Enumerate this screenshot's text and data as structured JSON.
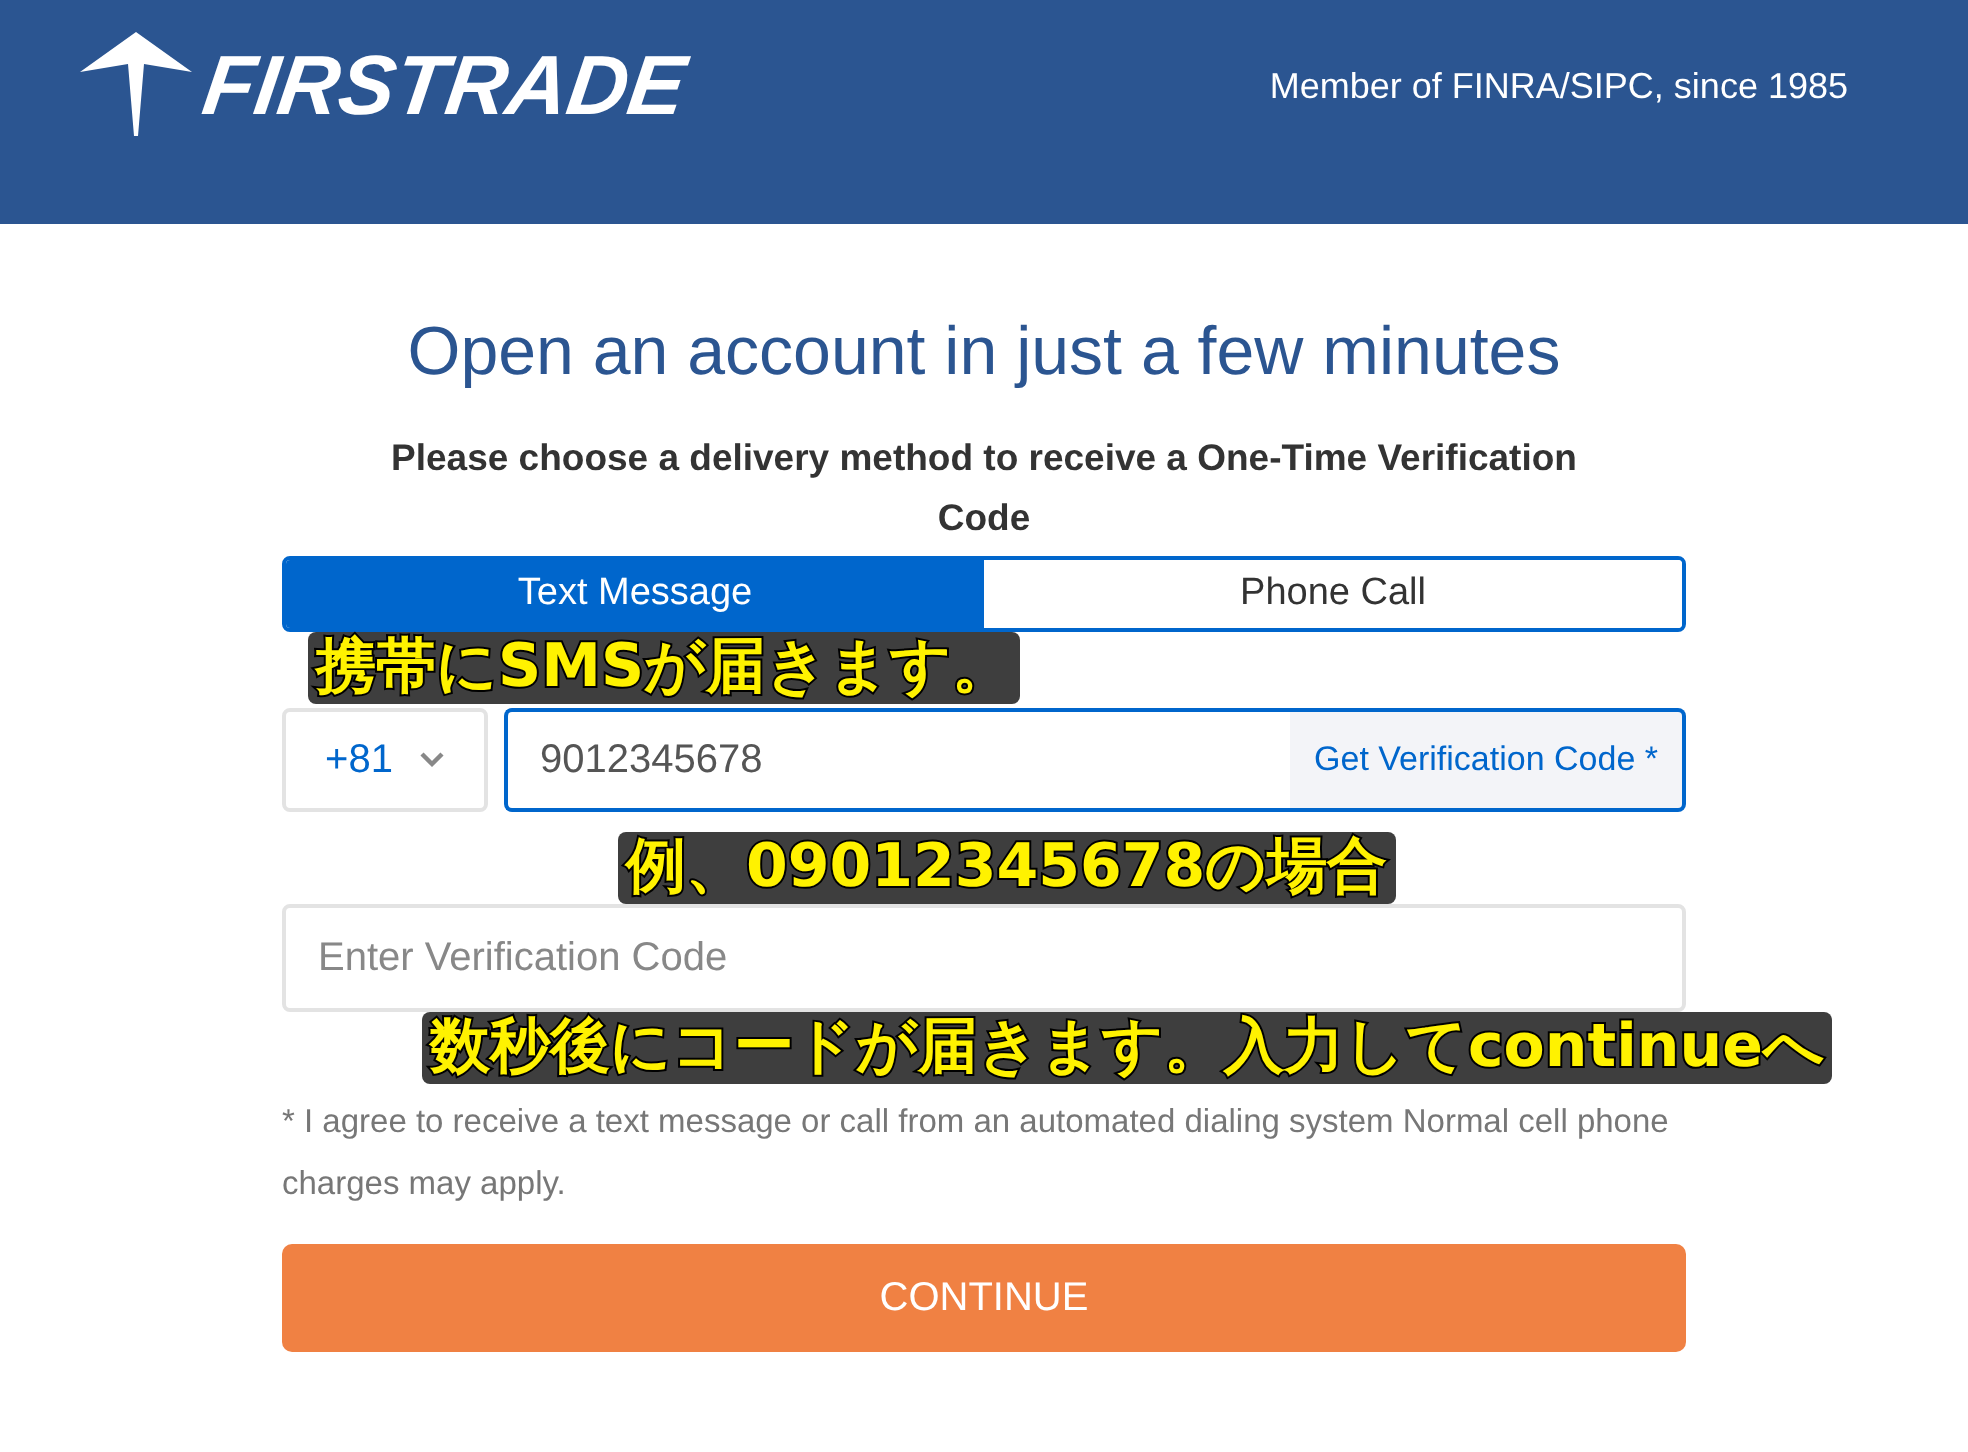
{
  "header": {
    "logo_text": "FIRSTRADE",
    "tagline": "Member of FINRA/SIPC, since 1985"
  },
  "title": "Open an account in just a few minutes",
  "subtitle": "Please choose a delivery method to receive a One-Time Verification Code",
  "tabs": [
    {
      "label": "Text Message",
      "selected": true
    },
    {
      "label": "Phone Call",
      "selected": false
    }
  ],
  "phone": {
    "country_code": "+81",
    "value": "9012345678",
    "button": "Get Verification Code *"
  },
  "code_field": {
    "placeholder": "Enter Verification Code"
  },
  "disclaimer": "* I agree to receive a text message or call from an automated dialing system Normal cell phone charges may apply.",
  "continue_button": "CONTINUE",
  "annotations": [
    {
      "text": "携帯にSMSが届きます。"
    },
    {
      "text": "例、09012345678の場合"
    },
    {
      "text": "数秒後にコードが届きます。入力してcontinueへ"
    }
  ]
}
